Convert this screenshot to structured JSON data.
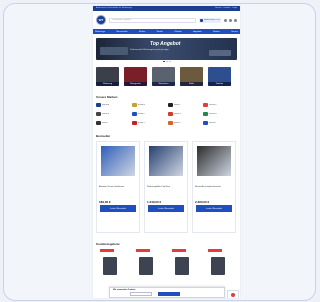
{
  "topbar": {
    "left_text": "Autorisierter Fachhändler für Werkzeuge",
    "right_text": "Service · Kontakt · Login"
  },
  "header": {
    "logo_text": "WT",
    "search_placeholder": "Suchbegriff eingeben...",
    "hotline_text": "Hotline 0800 123 456"
  },
  "nav": {
    "items": [
      "Werkzeuge",
      "Messtechnik",
      "Elektro",
      "Sanitär",
      "Zubehör",
      "Angebote",
      "Marken",
      "Service"
    ]
  },
  "banner": {
    "title": "Top Angebot",
    "subtitle": "Professionelle Werkzeugsets jetzt günstiger"
  },
  "categories": {
    "items": [
      {
        "label": "Werkzeug",
        "color": "#3a3f4a"
      },
      {
        "label": "Messgeräte",
        "color": "#7a1f28"
      },
      {
        "label": "Maschinen",
        "color": "#5a6270"
      },
      {
        "label": "Koffer",
        "color": "#6b5a3e"
      },
      {
        "label": "Zubehör",
        "color": "#2e4f8f"
      }
    ]
  },
  "brands_section": {
    "title": "Unsere Marken",
    "items": [
      {
        "name": "Brand A",
        "color": "#1b3f8f"
      },
      {
        "name": "Brand B",
        "color": "#c8a02a"
      },
      {
        "name": "Brand C",
        "color": "#222222"
      },
      {
        "name": "Brand D",
        "color": "#e23c3c"
      },
      {
        "name": "Brand E",
        "color": "#444444"
      },
      {
        "name": "Brand F",
        "color": "#1f4fbf"
      },
      {
        "name": "Brand G",
        "color": "#d23a2a"
      },
      {
        "name": "Brand H",
        "color": "#1f8a4a"
      },
      {
        "name": "Brand I",
        "color": "#333333"
      },
      {
        "name": "Brand J",
        "color": "#c82020"
      },
      {
        "name": "Brand K",
        "color": "#e06020"
      },
      {
        "name": "Brand L",
        "color": "#1f4fbf"
      }
    ]
  },
  "products_section": {
    "title": "Bestseller",
    "items": [
      {
        "name": "Abzieher Set mit Greifarmen",
        "price": "189,00 €",
        "button": "In den Warenkorb",
        "img_color": "#2f5fb8"
      },
      {
        "name": "Werkzeugkoffer Profi blau",
        "price": "1.249,00 €",
        "button": "In den Warenkorb",
        "img_color": "#26406f"
      },
      {
        "name": "Messkoffer komplett bestückt",
        "price": "2.390,00 €",
        "button": "In den Warenkorb",
        "img_color": "#2b2b2b"
      }
    ]
  },
  "sale_section": {
    "title": "Sonderangebote"
  },
  "cookie": {
    "title": "Wir verwenden Cookies",
    "text": "Diese Website nutzt Cookies, um Ihnen das beste Einkaufserlebnis zu bieten.",
    "accept_label": "Akzeptieren",
    "settings_label": "Einstellungen"
  }
}
